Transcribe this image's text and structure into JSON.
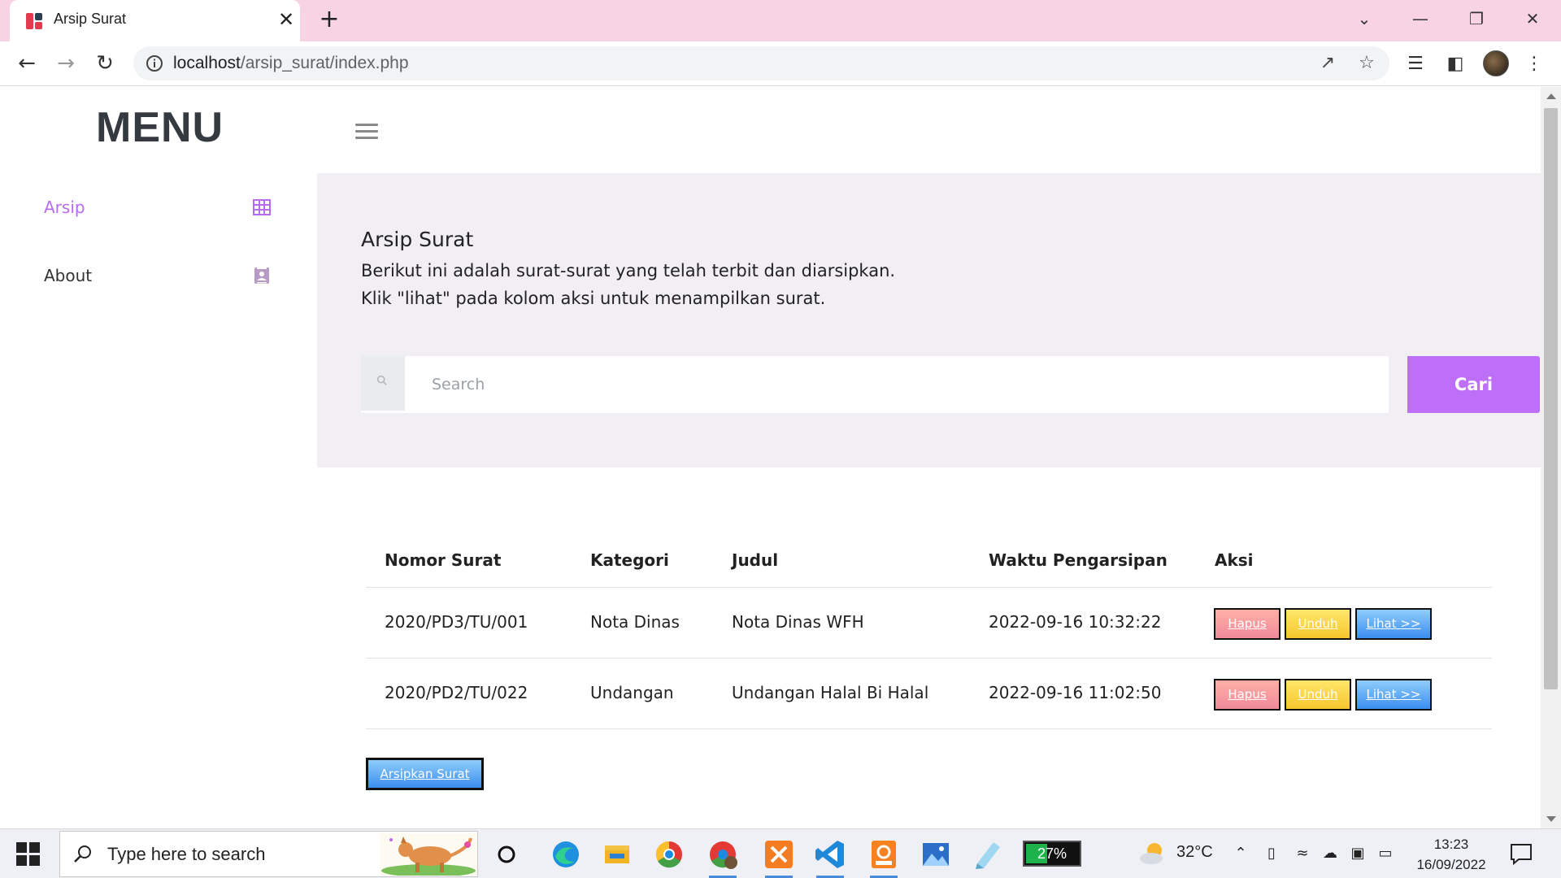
{
  "browser": {
    "tab_title": "Arsip Surat",
    "tab_close": "✕",
    "new_tab": "+",
    "url_host": "localhost",
    "url_path": "/arsip_surat/index.php",
    "window": {
      "dropdown": "⌄",
      "minimize": "—",
      "restore": "❐",
      "close": "✕"
    }
  },
  "sidebar": {
    "title": "MENU",
    "items": [
      {
        "label": "Arsip",
        "icon": "table-grid-icon",
        "active": true
      },
      {
        "label": "About",
        "icon": "contact-card-icon",
        "active": false
      }
    ]
  },
  "hero": {
    "title": "Arsip Surat",
    "line1": "Berikut ini adalah surat-surat yang telah terbit dan diarsipkan.",
    "line2": "Klik \"lihat\" pada kolom aksi untuk menampilkan surat."
  },
  "search": {
    "placeholder": "Search",
    "button": "Cari"
  },
  "table": {
    "headers": [
      "Nomor Surat",
      "Kategori",
      "Judul",
      "Waktu Pengarsipan",
      "Aksi"
    ],
    "rows": [
      {
        "nomor": "2020/PD3/TU/001",
        "kategori": "Nota Dinas",
        "judul": "Nota Dinas WFH",
        "waktu": "2022-09-16 10:32:22"
      },
      {
        "nomor": "2020/PD2/TU/022",
        "kategori": "Undangan",
        "judul": "Undangan Halal Bi Halal",
        "waktu": "2022-09-16 11:02:50"
      }
    ],
    "actions": {
      "hapus": "Hapus",
      "unduh": "Unduh",
      "lihat": "Lihat >>"
    }
  },
  "archive_button": "Arsipkan Surat",
  "taskbar": {
    "search_text": "Type here to search",
    "battery": "27%",
    "temperature": "32°C",
    "time": "13:23",
    "date": "16/09/2022"
  },
  "colors": {
    "accent_purple": "#bd70f7",
    "sidebar_active": "#b86bf0",
    "hero_bg": "#f1eef4",
    "tab_strip": "#f7d3e3"
  }
}
